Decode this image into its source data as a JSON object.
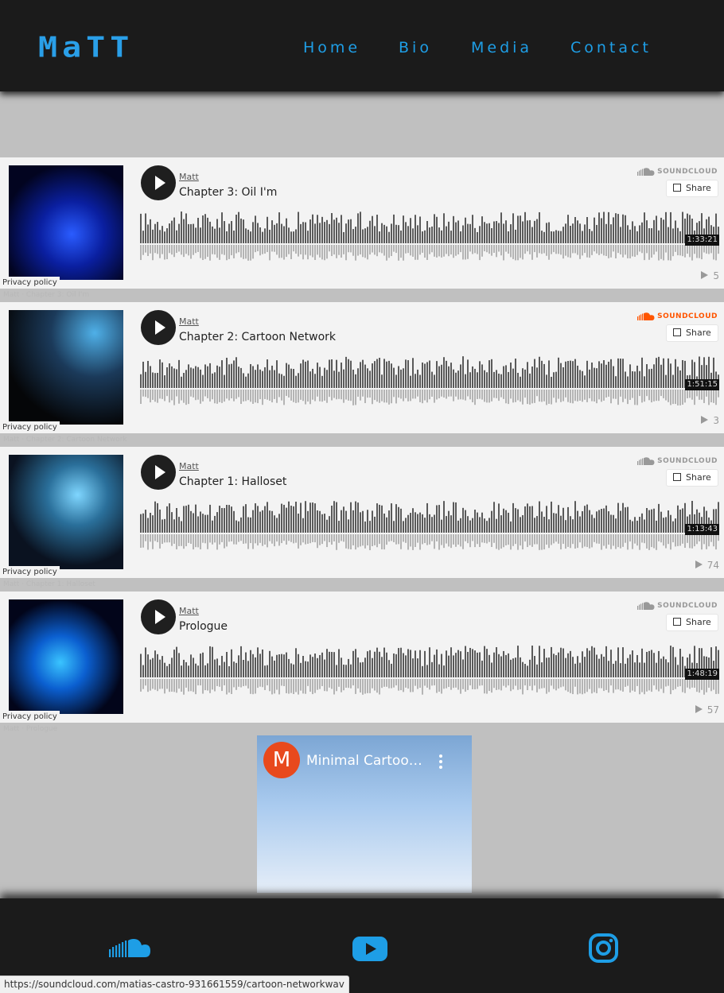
{
  "header": {
    "logo": "MaTT",
    "nav": [
      "Home",
      "Bio",
      "Media",
      "Contact"
    ]
  },
  "colors": {
    "accent": "#1e9ee6",
    "header_bg": "#1b1b1b",
    "page_bg": "#c0c0c0",
    "soundcloud_orange": "#ff5500"
  },
  "tracks": [
    {
      "artist": "Matt",
      "title": "Chapter 3: Oil I'm",
      "duration": "1:33:21",
      "plays": "5",
      "privacy": "Privacy policy",
      "brand": "SOUNDCLOUD",
      "share": "Share",
      "under": "Matt · Chapter 3: Oil I'm"
    },
    {
      "artist": "Matt",
      "title": "Chapter 2: Cartoon Network",
      "duration": "1:51:15",
      "plays": "3",
      "privacy": "Privacy policy",
      "brand": "SOUNDCLOUD",
      "share": "Share",
      "under": "Matt · Chapter 2: Cartoon Network"
    },
    {
      "artist": "Matt",
      "title": "Chapter 1: Halloset",
      "duration": "1:13:43",
      "plays": "74",
      "privacy": "Privacy policy",
      "brand": "SOUNDCLOUD",
      "share": "Share",
      "under": "Matt · Chapter 1: Halloset"
    },
    {
      "artist": "Matt",
      "title": "Prologue",
      "duration": "1:48:19",
      "plays": "57",
      "privacy": "Privacy policy",
      "brand": "SOUNDCLOUD",
      "share": "Share",
      "under": "Matt · Prologue"
    }
  ],
  "youtube": {
    "avatar_letter": "M",
    "title": "Minimal Cartoon Network"
  },
  "footer": {
    "icons": [
      "soundcloud-icon",
      "youtube-icon",
      "instagram-icon"
    ]
  },
  "status_url": "https://soundcloud.com/matias-castro-931661559/cartoon-networkwav"
}
